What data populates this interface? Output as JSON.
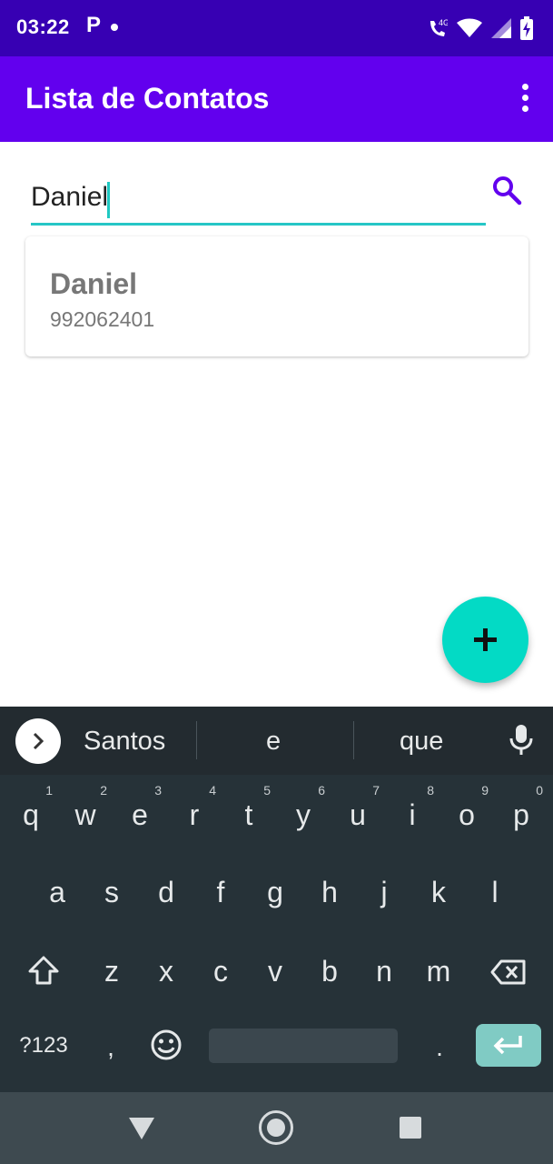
{
  "status_bar": {
    "time": "03:22",
    "notification_icon": "P",
    "icons": [
      "wifi-calling-4g-icon",
      "wifi-icon",
      "signal-icon",
      "battery-charging-icon"
    ]
  },
  "app_bar": {
    "title": "Lista de Contatos",
    "overflow_icon": "more-vert-icon"
  },
  "search": {
    "value": "Daniel",
    "placeholder": "",
    "icon": "search-icon",
    "accent_color": "#26c6c6"
  },
  "contacts": [
    {
      "name": "Daniel",
      "phone": "992062401"
    }
  ],
  "fab": {
    "icon": "plus-icon",
    "color": "#03dac5"
  },
  "keyboard": {
    "suggestions": [
      "Santos",
      "e",
      "que"
    ],
    "row1": [
      {
        "key": "q",
        "hint": "1"
      },
      {
        "key": "w",
        "hint": "2"
      },
      {
        "key": "e",
        "hint": "3"
      },
      {
        "key": "r",
        "hint": "4"
      },
      {
        "key": "t",
        "hint": "5"
      },
      {
        "key": "y",
        "hint": "6"
      },
      {
        "key": "u",
        "hint": "7"
      },
      {
        "key": "i",
        "hint": "8"
      },
      {
        "key": "o",
        "hint": "9"
      },
      {
        "key": "p",
        "hint": "0"
      }
    ],
    "row2": [
      "a",
      "s",
      "d",
      "f",
      "g",
      "h",
      "j",
      "k",
      "l"
    ],
    "row3": [
      "z",
      "x",
      "c",
      "v",
      "b",
      "n",
      "m"
    ],
    "symbols_label": "?123",
    "comma_label": ",",
    "period_label": "."
  },
  "colors": {
    "status_bar": "#3700b3",
    "app_bar": "#6200ee",
    "keyboard": "#263238",
    "nav_bar": "#3e4a50"
  }
}
